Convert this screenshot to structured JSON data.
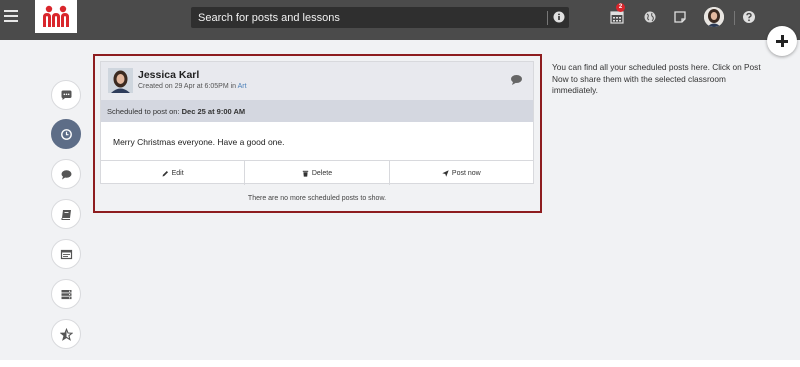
{
  "app": {
    "brand_color": "#d9262c",
    "topbar_color": "#4b4b4b",
    "search": {
      "placeholder": "Search for posts and lessons"
    },
    "notifications_count": "2"
  },
  "icons": {
    "menu": "hamburger-icon",
    "info": "info-icon",
    "calendar": "calendar-icon",
    "globe": "globe-icon",
    "note": "sticky-note-icon",
    "help": "question-icon",
    "add": "plus-icon"
  },
  "sidebar": {
    "items": [
      {
        "name": "comments-icon",
        "active": false
      },
      {
        "name": "clock-icon",
        "active": true
      },
      {
        "name": "chat-icon",
        "active": false
      },
      {
        "name": "book-icon",
        "active": false
      },
      {
        "name": "browser-icon",
        "active": false
      },
      {
        "name": "server-icon",
        "active": false
      },
      {
        "name": "star-icon",
        "active": false
      }
    ]
  },
  "post": {
    "author": "Jessica Karl",
    "created_prefix": "Created on 29 Apr at 6:05PM in ",
    "category": "Art",
    "scheduled_prefix": "Scheduled to post on: ",
    "scheduled_time": "Dec 25 at 9:00 AM",
    "body": "Merry Christmas everyone. Have a good one.",
    "actions": {
      "edit": "Edit",
      "delete": "Delete",
      "post_now": "Post now"
    }
  },
  "empty_message": "There are no more scheduled posts to show.",
  "help_text": "You can find all your scheduled posts here. Click on Post Now to share them with the selected classroom immediately."
}
